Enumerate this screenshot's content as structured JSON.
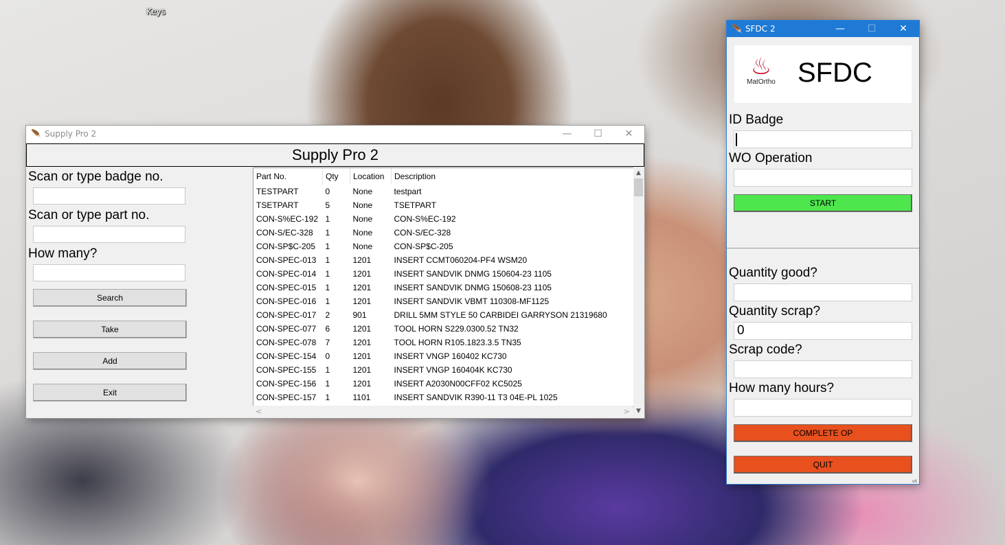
{
  "desktop": {
    "icon_label": "Keys"
  },
  "supply_pro": {
    "window_title": "Supply Pro 2",
    "header": "Supply Pro 2",
    "labels": {
      "badge": "Scan or type badge no.",
      "part": "Scan or type part no.",
      "how_many": "How many?"
    },
    "buttons": {
      "search": "Search",
      "take": "Take",
      "add": "Add",
      "exit": "Exit"
    },
    "table": {
      "columns": [
        "Part No.",
        "Qty",
        "Location",
        "Description"
      ],
      "rows": [
        [
          "TESTPART",
          "0",
          "None",
          "testpart"
        ],
        [
          "TSETPART",
          "5",
          "None",
          "TSETPART"
        ],
        [
          "CON-S%EC-192",
          "1",
          "None",
          "CON-S%EC-192"
        ],
        [
          "CON-S/EC-328",
          "1",
          "None",
          "CON-S/EC-328"
        ],
        [
          "CON-SP$C-205",
          "1",
          "None",
          "CON-SP$C-205"
        ],
        [
          "CON-SPEC-013",
          "1",
          "1201",
          "INSERT CCMT060204-PF4 WSM20"
        ],
        [
          "CON-SPEC-014",
          "1",
          "1201",
          "INSERT SANDVIK DNMG 150604-23 1105"
        ],
        [
          "CON-SPEC-015",
          "1",
          "1201",
          "INSERT SANDVIK DNMG 150608-23 1105"
        ],
        [
          "CON-SPEC-016",
          "1",
          "1201",
          "INSERT SANDVIK VBMT 110308-MF1125"
        ],
        [
          "CON-SPEC-017",
          "2",
          "901",
          "DRILL 5MM STYLE 50 CARBIDEI GARRYSON 21319680"
        ],
        [
          "CON-SPEC-077",
          "6",
          "1201",
          "TOOL HORN S229.0300.52 TN32"
        ],
        [
          "CON-SPEC-078",
          "7",
          "1201",
          "TOOL HORN R105.1823.3.5 TN35"
        ],
        [
          "CON-SPEC-154",
          "0",
          "1201",
          "INSERT VNGP 160402 KC730"
        ],
        [
          "CON-SPEC-155",
          "1",
          "1201",
          "INSERT VNGP 160404K KC730"
        ],
        [
          "CON-SPEC-156",
          "1",
          "1201",
          "INSERT A2030N00CFF02 KC5025"
        ],
        [
          "CON-SPEC-157",
          "1",
          "1101",
          "INSERT SANDVIK R390-11 T3 04E-PL 1025"
        ]
      ]
    }
  },
  "sfdc": {
    "window_title": "SFDC 2",
    "logo_brand": "MatOrtho",
    "logo_text": "SFDC",
    "labels": {
      "id_badge": "ID Badge",
      "wo_operation": "WO Operation",
      "qty_good": "Quantity good?",
      "qty_scrap": "Quantity scrap?",
      "scrap_code": "Scrap code?",
      "hours": "How many hours?"
    },
    "values": {
      "qty_scrap": "0"
    },
    "buttons": {
      "start": "START",
      "complete": "COMPLETE OP",
      "quit": "QUIT"
    },
    "colors": {
      "start": "#4de64d",
      "complete": "#e8501e",
      "quit": "#e8501e",
      "titlebar": "#1f7ad6"
    },
    "version": "v6"
  }
}
